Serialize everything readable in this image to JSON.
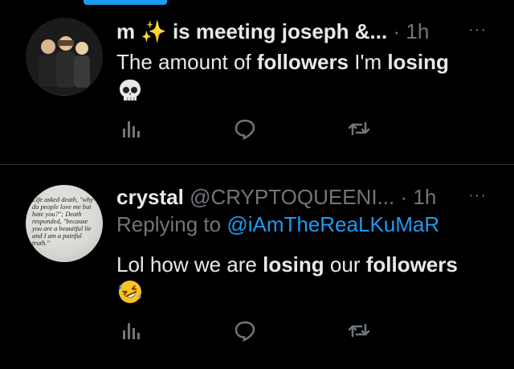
{
  "tweets": [
    {
      "name": "m ✨ is meeting joseph &...",
      "meta_sep": "·",
      "time": "1h",
      "more": "···",
      "text_parts": [
        "The amount of ",
        "followers",
        " I'm ",
        "losing"
      ],
      "emoji": "skull-emoji"
    },
    {
      "name": "crystal",
      "handle": "@CRYPTOQUEENI...",
      "meta_sep": "·",
      "time": "1h",
      "more": "···",
      "replying_prefix": "Replying to ",
      "replying_to": "@iAmTheReaLKuMaR",
      "text_parts": [
        "Lol how we are ",
        "losing",
        " our ",
        "followers"
      ],
      "emoji": "rofl-emoji",
      "avatar_quote": "Life asked death, \"why do people love me but hate you?\"; Death responded, \"because you are a beautiful lie and I am a painful truth.\""
    }
  ],
  "colors": {
    "background": "#000000",
    "text": "#e7e9ea",
    "muted": "#71767b",
    "accent": "#1d9bf0",
    "divider": "#2f3336"
  }
}
